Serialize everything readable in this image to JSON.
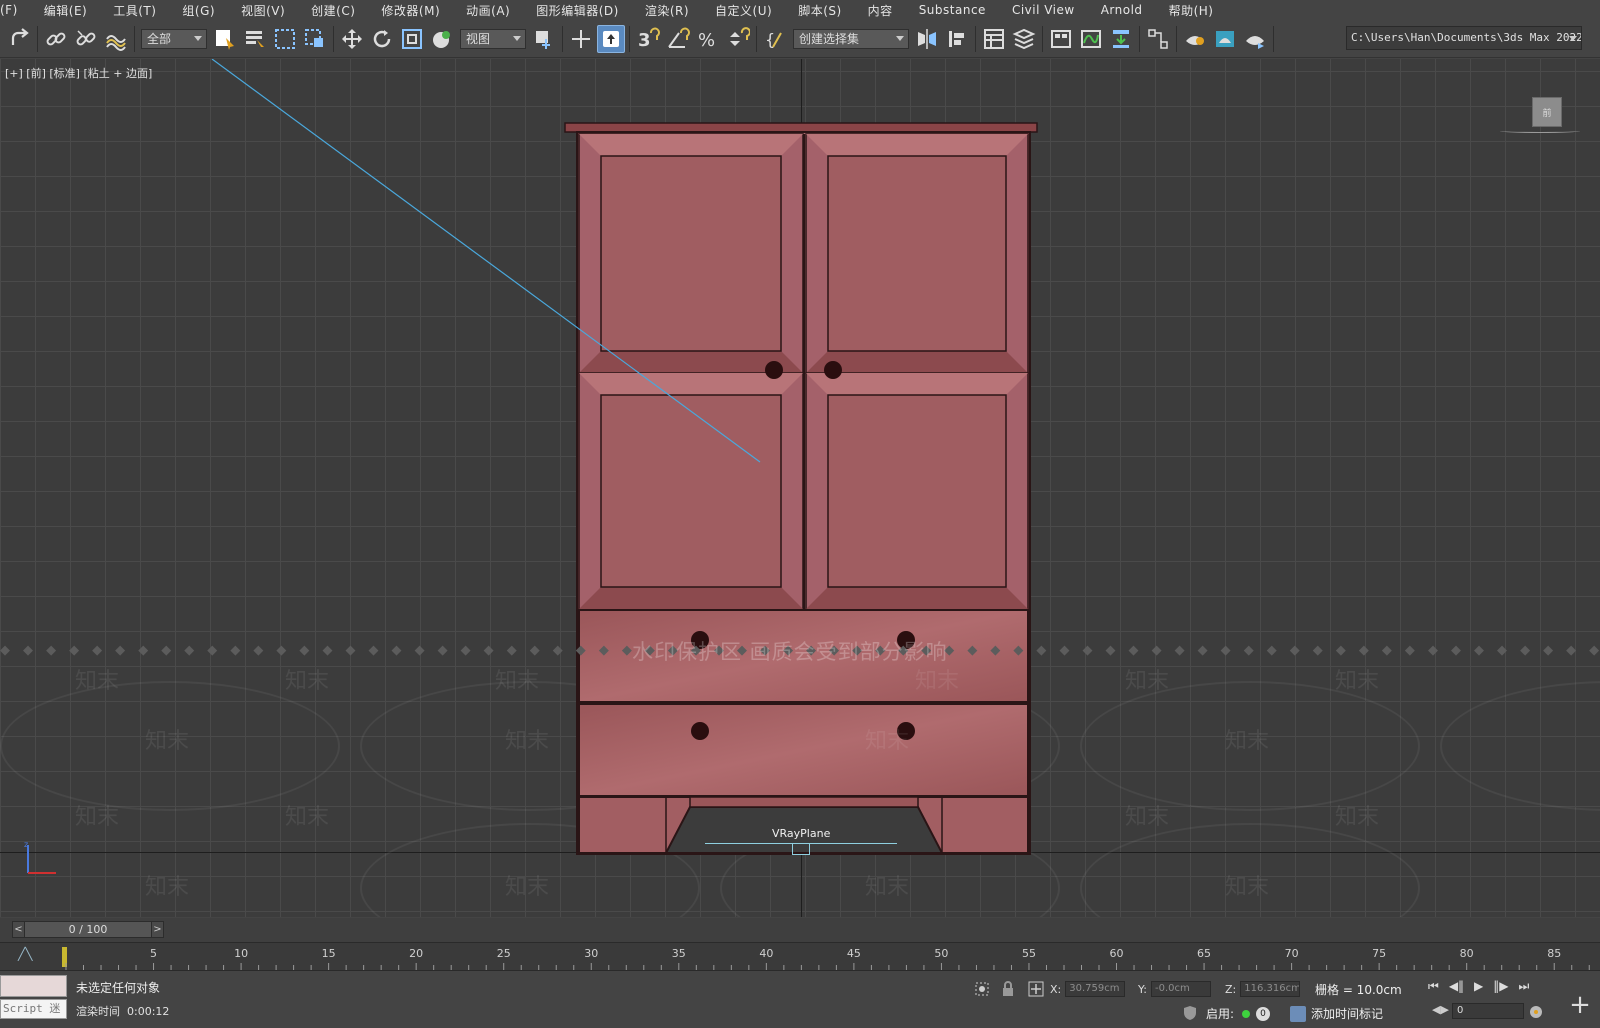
{
  "menu": {
    "items": [
      "(F)",
      "编辑(E)",
      "工具(T)",
      "组(G)",
      "视图(V)",
      "创建(C)",
      "修改器(M)",
      "动画(A)",
      "图形编辑器(D)",
      "渲染(R)",
      "自定义(U)",
      "脚本(S)",
      "内容",
      "Substance",
      "Civil View",
      "Arnold",
      "帮助(H)"
    ]
  },
  "toolbar": {
    "filter_value": "全部",
    "refcoord_value": "视图",
    "selection_set_value": "创建选择集",
    "project_path": "C:\\Users\\Han\\Documents\\3ds Max 2022",
    "snap_label": "3"
  },
  "viewport": {
    "label": "[+] [前] [标准] [粘土 + 边面]",
    "object_label": "VRayPlane",
    "viewcube_face": "前",
    "watermark_notice": "水印保护区  画质会受到部分影响",
    "watermark_brand": "知末"
  },
  "timeline": {
    "frame_display": "0 / 100",
    "tick_labels": [
      "5",
      "10",
      "15",
      "20",
      "25",
      "30",
      "35",
      "40",
      "45",
      "50",
      "55",
      "60",
      "65",
      "70",
      "75",
      "80",
      "85"
    ],
    "total_frames": 100
  },
  "status": {
    "message": "未选定任何对象",
    "render_time_label": "渲染时间",
    "render_time_value": "0:00:12",
    "listener_text": "Script 迷",
    "x_label": "X:",
    "x_value": "30.759cm",
    "y_label": "Y:",
    "y_value": "-0.0cm",
    "z_label": "Z:",
    "z_value": "116.316cm",
    "grid_label": "栅格 = 10.0cm",
    "enable_label": "启用:",
    "enable_count": "0",
    "add_time_tag": "添加时间标记",
    "current_frame": "0"
  },
  "colors": {
    "cabinet": "#a65f62",
    "cabinet_dark": "#7c3c3f",
    "accent_blue": "#5a8ac0",
    "key_marker": "#c8b830"
  }
}
